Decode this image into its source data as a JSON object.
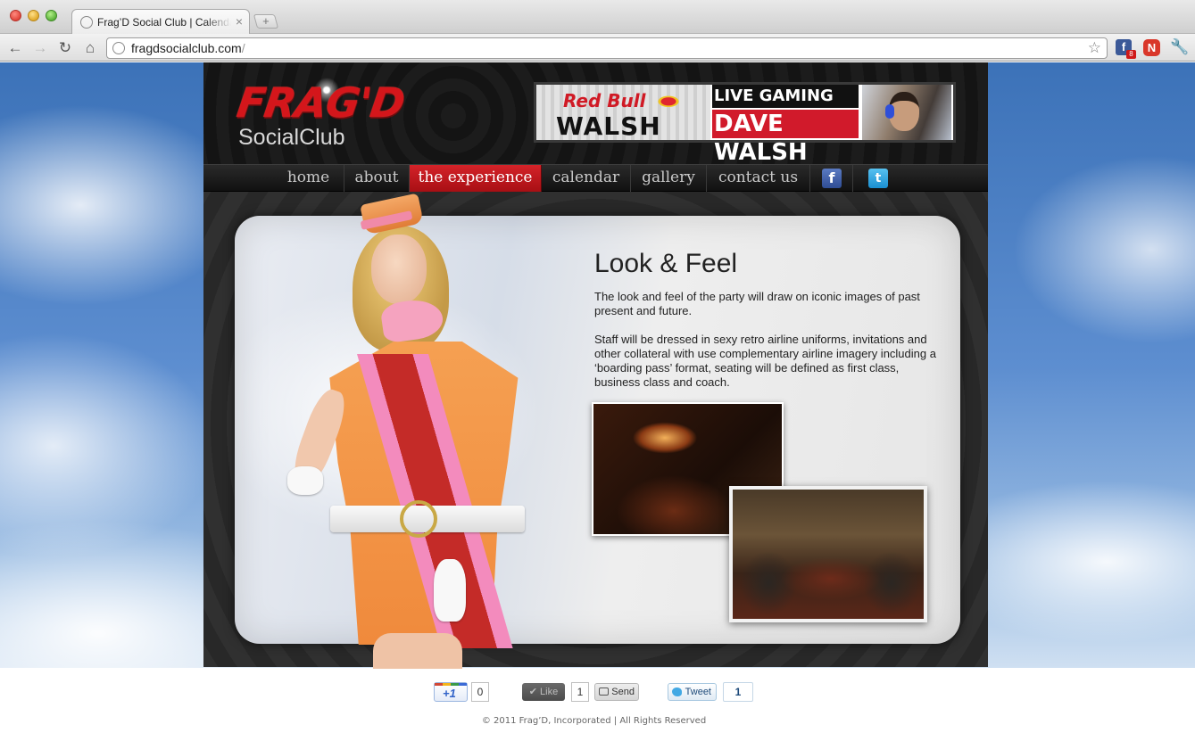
{
  "browser": {
    "tab_title": "Frag’D Social Club | Calendar",
    "tab_close": "×",
    "new_tab": "+",
    "url_host": "fragdsocialclub.com",
    "url_slash": "/",
    "back_icon": "←",
    "forward_icon": "→",
    "reload_icon": "↻",
    "home_icon": "⌂",
    "star_icon": "☆",
    "wrench_icon": "🔧",
    "extensions": {
      "facebook": "f",
      "facebook_badge": "8",
      "n_ext": "N"
    }
  },
  "site": {
    "logo": {
      "frag": "FRAG'D",
      "social": "SocialClub"
    },
    "banner": {
      "brand": "Red Bull",
      "walsh": "WALSH",
      "line1": "LIVE GAMING WITH",
      "line2": "DAVE WALSH"
    },
    "nav": {
      "items": [
        "home",
        "about",
        "the experience",
        "calendar",
        "gallery",
        "contact us"
      ],
      "active": "the experience",
      "facebook_icon": "f",
      "twitter_icon": "t"
    },
    "content": {
      "heading": "Look & Feel",
      "paragraph1": "The look and feel of the party will draw on iconic images of past present and future.",
      "paragraph2": "Staff will be dressed in sexy retro airline uniforms, invitations and other collateral with  use complementary airline imagery including a ‘boarding pass’ format, seating will be defined as first class, business class and coach."
    }
  },
  "social": {
    "gplus_label": "+1",
    "gplus_count": "0",
    "like_label": "✔ Like",
    "like_count": "1",
    "send_label": "Send",
    "tweet_label": "Tweet",
    "tweet_count": "1"
  },
  "footer": {
    "copyright": "© 2011 Frag’D, Incorporated  |  All Rights Reserved"
  },
  "colors": {
    "accent_red": "#d42329",
    "nav_bg": "#1b1b1b",
    "sky_blue": "#4b7fc4"
  }
}
